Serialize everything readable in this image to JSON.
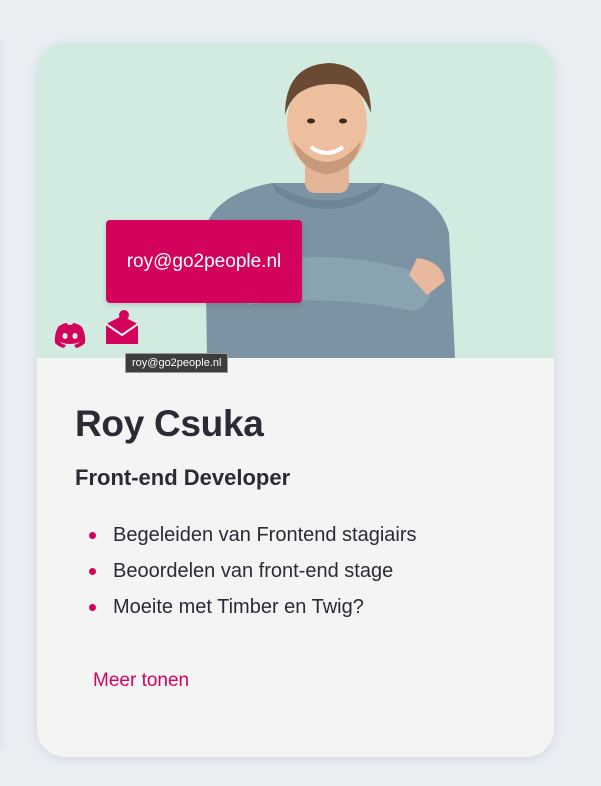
{
  "profile": {
    "name": "Roy Csuka",
    "role": "Front-end Developer",
    "email": "roy@go2people.nl",
    "tooltip": "roy@go2people.nl",
    "tasks": [
      "Begeleiden van Frontend stagiairs",
      "Beoordelen van front-end stage",
      "Moeite met Timber en Twig?"
    ],
    "more_label": "Meer tonen"
  },
  "icons": {
    "discord": "discord-icon",
    "mail": "mail-icon"
  },
  "colors": {
    "accent": "#d3035b",
    "hero_bg": "#d1ebe1",
    "card_bg": "#f4f4f4",
    "text": "#2b2a35",
    "page_bg": "#e9eef3"
  }
}
